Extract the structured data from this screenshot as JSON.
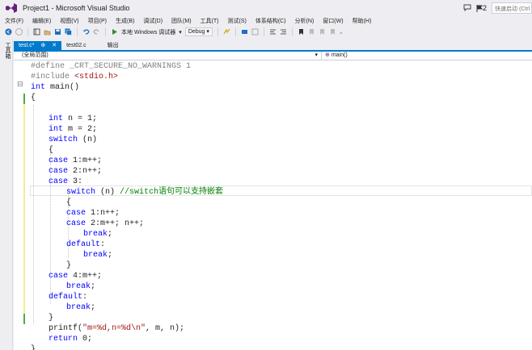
{
  "title": "Project1 - Microsoft Visual Studio",
  "notifications_count": "2",
  "quick_launch_placeholder": "快速启动 (Ctrl",
  "menu": [
    "文件(F)",
    "编辑(E)",
    "视图(V)",
    "项目(P)",
    "生成(B)",
    "调试(D)",
    "团队(M)",
    "工具(T)",
    "测试(S)",
    "体系结构(C)",
    "分析(N)",
    "窗口(W)",
    "帮助(H)"
  ],
  "toolbar": {
    "run_label": "本地 Windows 调试器",
    "config": "Debug"
  },
  "toolbox_label": "工具箱",
  "tabs": [
    {
      "label": "test.c*",
      "pin": "⊕",
      "close": "✕"
    },
    {
      "label": "test02.c"
    },
    {
      "label": "输出"
    }
  ],
  "nav": {
    "scope": "(全局范围)",
    "member": "main()"
  },
  "code": {
    "l1": [
      "#define _CRT_SECURE_NO_WARNINGS 1"
    ],
    "l2": [
      "#include ",
      "<stdio.h>"
    ],
    "l3": [
      "int",
      " main()"
    ],
    "l4": [
      "{"
    ],
    "l5": [
      "int",
      " n = 1;"
    ],
    "l6": [
      "int",
      " m = 2;"
    ],
    "l7": [
      "switch",
      " (n)"
    ],
    "l8": [
      "{"
    ],
    "l9": [
      "case",
      " 1:m++;"
    ],
    "l10": [
      "case",
      " 2:n++;"
    ],
    "l11": [
      "case",
      " 3:"
    ],
    "l12": [
      "switch",
      " (n) ",
      "//switch语句可以支持嵌套"
    ],
    "l13": [
      "{"
    ],
    "l14": [
      "case",
      " 1:n++;"
    ],
    "l15": [
      "case",
      " 2:m++; n++;"
    ],
    "l16": [
      "break",
      ";"
    ],
    "l17": [
      "default",
      ":"
    ],
    "l18": [
      "break",
      ";"
    ],
    "l19": [
      "}"
    ],
    "l20": [
      "case",
      " 4:m++;"
    ],
    "l21": [
      "break",
      ";"
    ],
    "l22": [
      "default",
      ":"
    ],
    "l23": [
      "break",
      ";"
    ],
    "l24": [
      "}"
    ],
    "l25": [
      "printf(",
      "\"m=%d,n=%d\\n\"",
      ", m, n);"
    ],
    "l26": [
      "return",
      " 0;"
    ],
    "l27": [
      "}"
    ]
  },
  "colors": {
    "accent": "#007acc",
    "keyword": "#0000ff",
    "string": "#a31515",
    "comment": "#008000",
    "preprocessor": "#808080"
  }
}
